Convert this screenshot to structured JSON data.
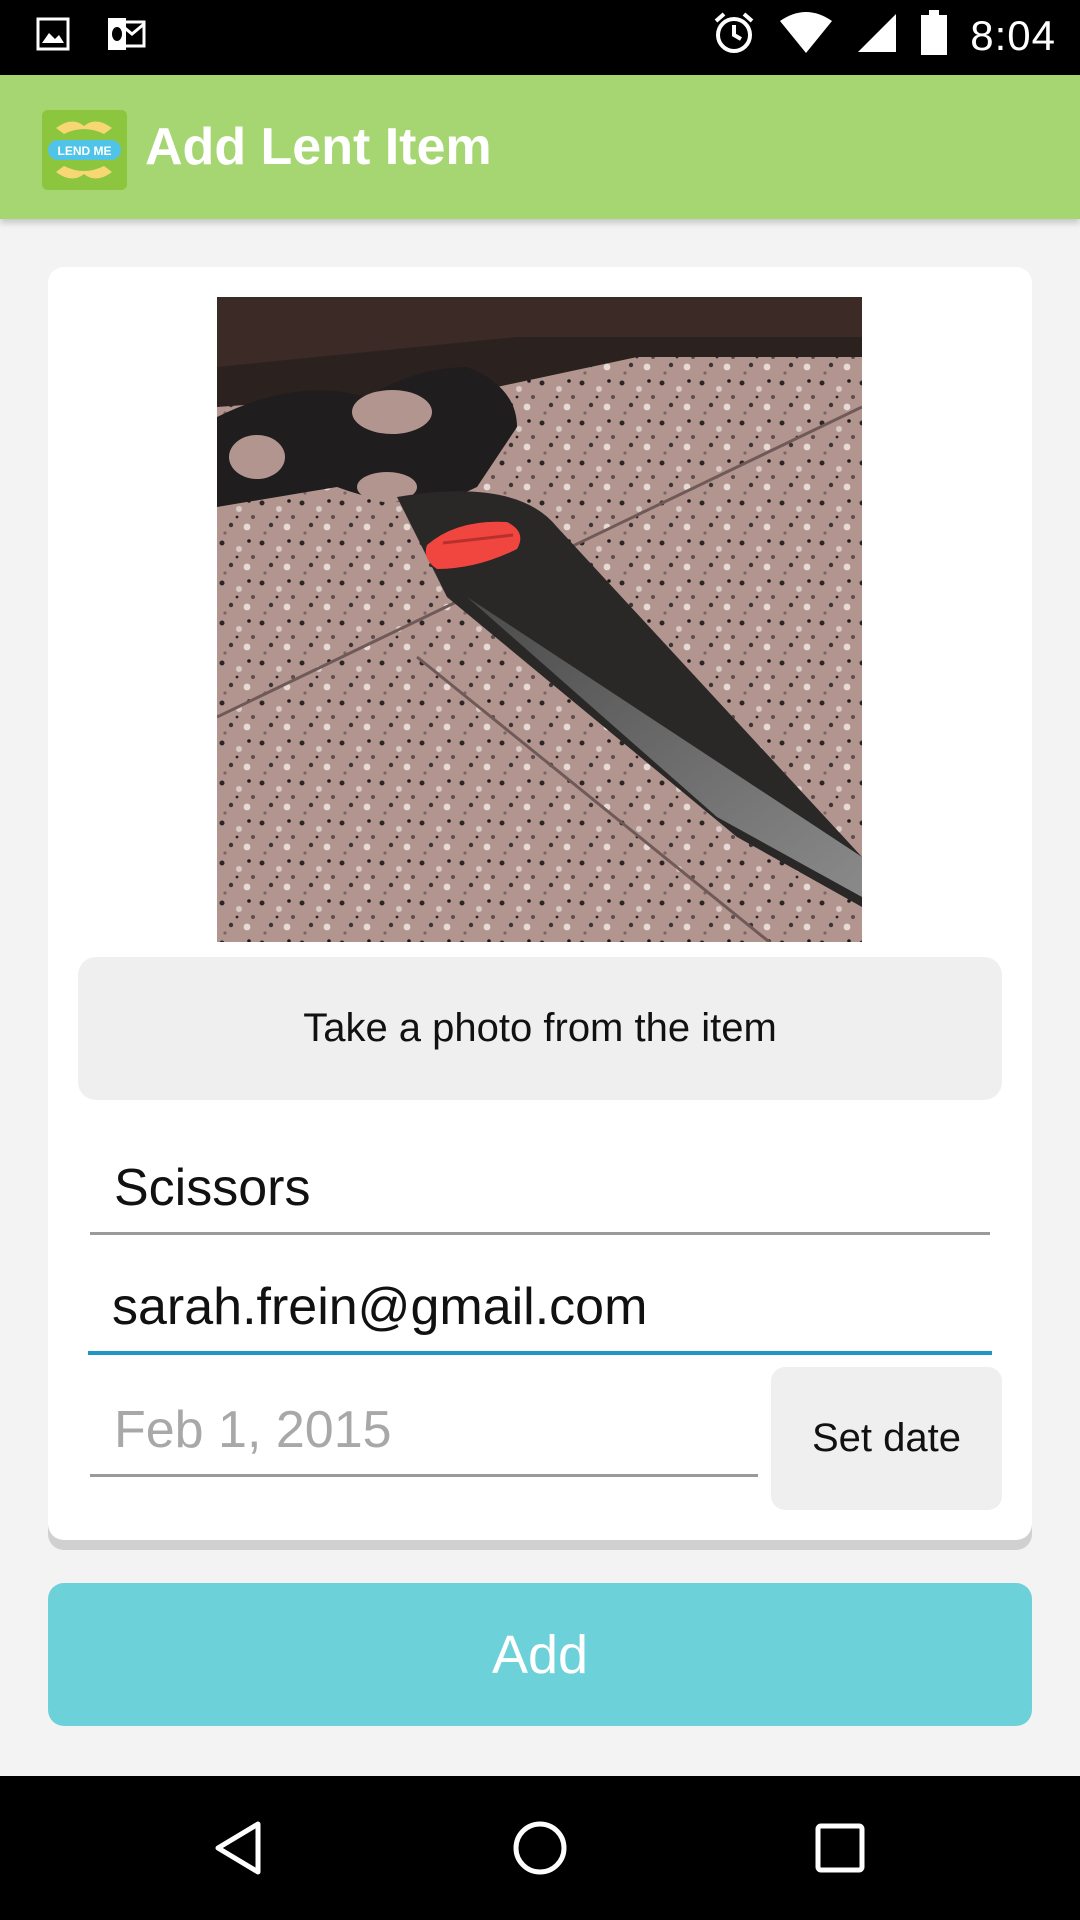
{
  "status_bar": {
    "time": "8:04",
    "left_icons": [
      "image-notification-icon",
      "outlook-notification-icon"
    ],
    "right_icons": [
      "alarm-icon",
      "wifi-icon",
      "signal-icon",
      "battery-icon"
    ]
  },
  "app_bar": {
    "logo_text": "LEND ME",
    "title": "Add Lent Item",
    "color": "#a6d672"
  },
  "form": {
    "photo_alt": "item photo",
    "take_photo_label": "Take a photo from the item",
    "item_name": "Scissors",
    "email": "sarah.frein@gmail.com",
    "date_placeholder": "Feb 1, 2015",
    "set_date_label": "Set date"
  },
  "add_button": {
    "label": "Add",
    "color": "#6dd1da"
  },
  "nav_bar": {
    "buttons": [
      "back-icon",
      "home-icon",
      "recents-icon"
    ]
  },
  "colors": {
    "accent": "#1f97c6"
  }
}
